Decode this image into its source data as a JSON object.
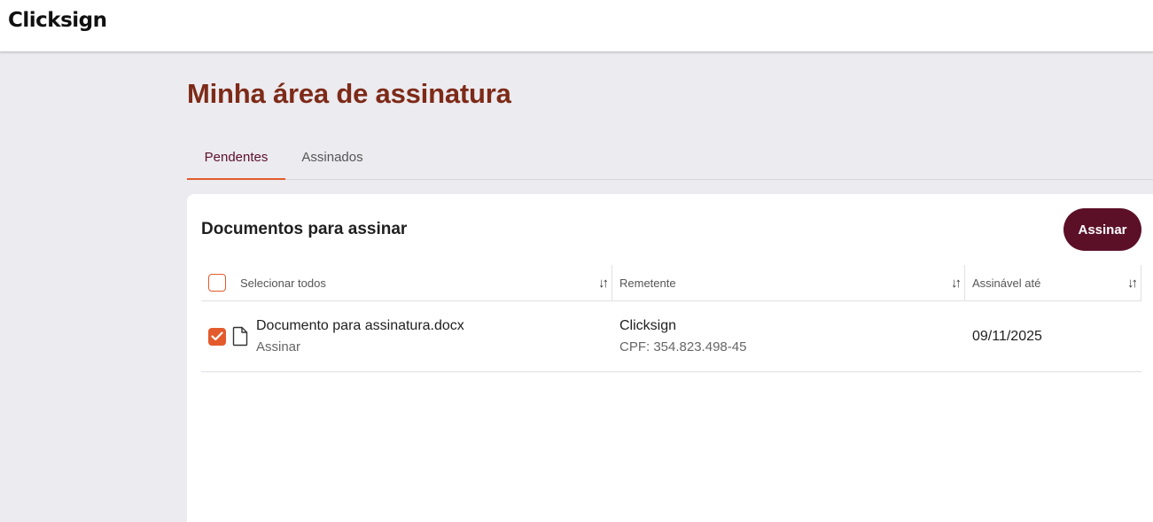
{
  "header": {
    "logo_text": "Clicksign"
  },
  "page": {
    "title": "Minha área de assinatura"
  },
  "tabs": [
    {
      "label": "Pendentes",
      "active": true
    },
    {
      "label": "Assinados",
      "active": false
    }
  ],
  "card": {
    "title": "Documentos para assinar",
    "sign_button_label": "Assinar"
  },
  "table": {
    "columns": [
      "Selecionar todos",
      "Remetente",
      "Assinável até"
    ],
    "rows": [
      {
        "selected": true,
        "document_name": "Documento para assinatura.docx",
        "action": "Assinar",
        "sender_name": "Clicksign",
        "sender_cpf": "CPF: 354.823.498-45",
        "signable_until": "09/11/2025"
      }
    ]
  },
  "icons": {
    "sort": "sort-arrows-icon",
    "document": "document-icon",
    "checkmark": "checkmark-icon"
  },
  "colors": {
    "brand_primary": "#5b1028",
    "accent": "#e35b2c",
    "title": "#7d2a18",
    "background": "#ecebef"
  }
}
